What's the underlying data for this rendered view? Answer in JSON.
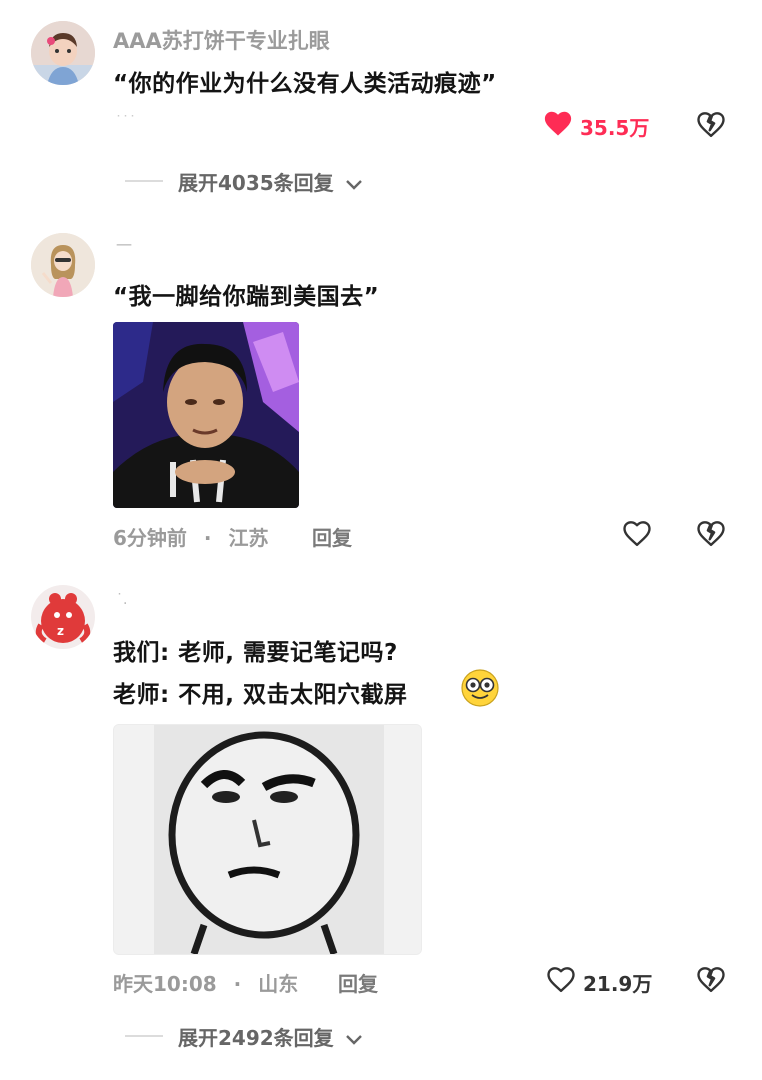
{
  "comments": [
    {
      "username": "AAA苏打饼干专业扎眼",
      "text": "“你的作业为什么没有人类活动痕迹”",
      "like_count": "35.5万",
      "expand": "展开4035条回复"
    },
    {
      "username": "",
      "text": "“我一脚给你踹到美国去”",
      "time": "6分钟前",
      "location": "江苏",
      "reply_label": "回复"
    },
    {
      "username": "",
      "line1": "我们: 老师, 需要记笔记吗?",
      "line2": "老师: 不用, 双击太阳穴截屏",
      "time": "昨天10:08",
      "location": "山东",
      "reply_label": "回复",
      "like_count": "21.9万",
      "expand": "展开2492条回复"
    }
  ],
  "separator": "·",
  "colors": {
    "liked": "#fe2c55",
    "icon": "#333333"
  }
}
